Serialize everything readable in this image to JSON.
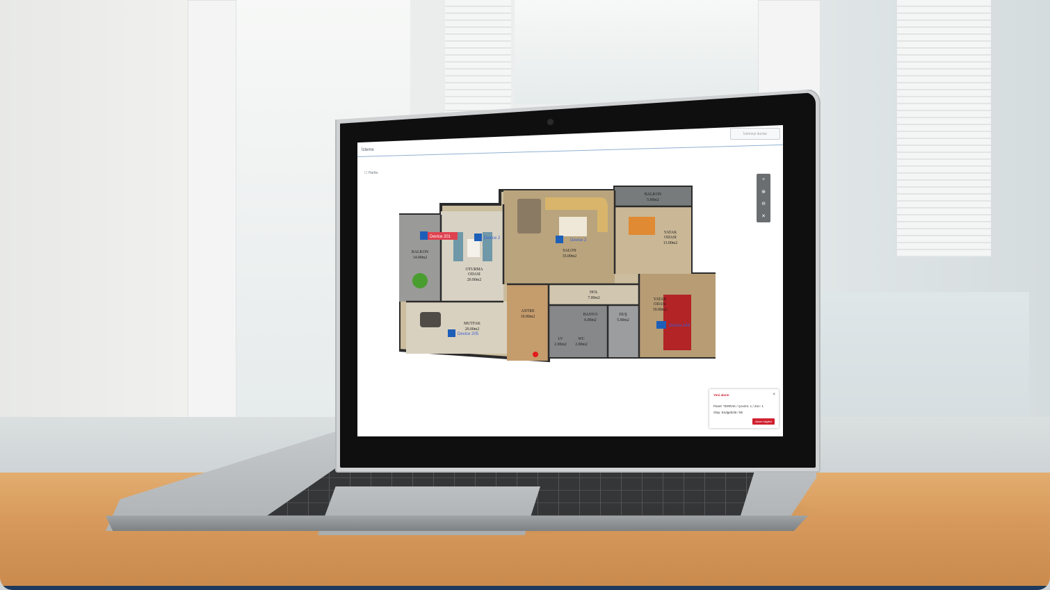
{
  "app": {
    "title": "İzleme",
    "top_button": "İzlemeyi durdur",
    "breadcrumb": "☐ Harita"
  },
  "zoom_tools": [
    "+",
    "⊕",
    "⊖",
    "✕"
  ],
  "rooms": [
    {
      "name": "BALKON",
      "area": "5.00m2"
    },
    {
      "name": "BALKON",
      "area": "14.00m2"
    },
    {
      "name": "OTURMA\nODASI",
      "area": "20.00m2"
    },
    {
      "name": "SALON",
      "area": "35.00m2"
    },
    {
      "name": "YATAK\nODASI",
      "area": "13.00m2"
    },
    {
      "name": "HOL",
      "area": "7.00m2"
    },
    {
      "name": "YATAK\nODASI",
      "area": "19.00m2"
    },
    {
      "name": "ANTRE",
      "area": "10.00m2"
    },
    {
      "name": "BANYO",
      "area": "6.00m2"
    },
    {
      "name": "DUŞ",
      "area": "5.00m2"
    },
    {
      "name": "MUTFAK",
      "area": "20.00m2"
    },
    {
      "name": "LV",
      "area": "2.00m2"
    },
    {
      "name": "WC",
      "area": "2.00m2"
    }
  ],
  "devices": [
    {
      "id": "201",
      "label": "Device 201",
      "alarm": true
    },
    {
      "id": "...",
      "label": "Device 2",
      "alarm": false
    },
    {
      "id": "2",
      "label": "Device 2",
      "alarm": false
    },
    {
      "id": "244",
      "label": "Device 244",
      "alarm": false
    },
    {
      "id": "205",
      "label": "Device 205",
      "alarm": false
    }
  ],
  "alert": {
    "title": "Yeni alarm",
    "line1": "Panel: TERRAK / Çevrim: 1 / Zon: 1",
    "line2": "Olay: Endgebölü / 86",
    "button": "Alarm bilgileri"
  },
  "colors": {
    "accent": "#d0202e",
    "header_line": "#8fb0d0",
    "footer_bar": "#1d3a5e"
  }
}
